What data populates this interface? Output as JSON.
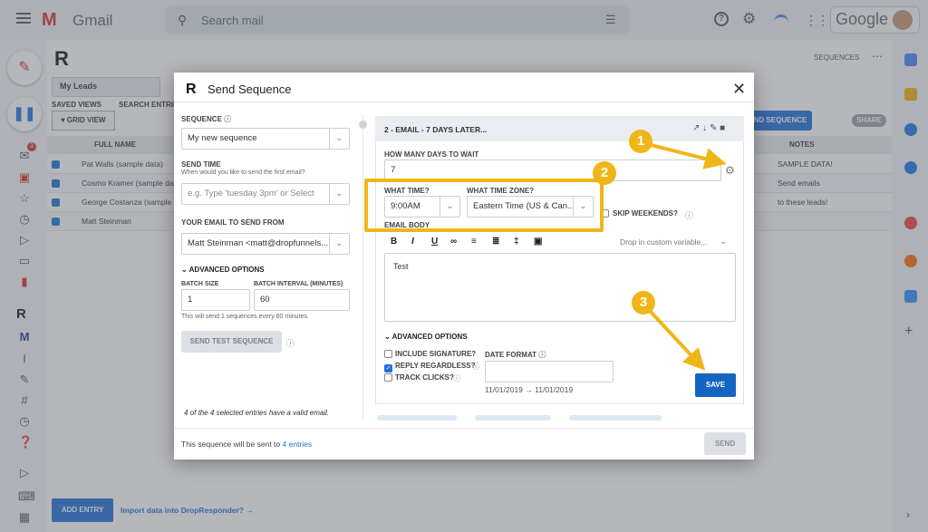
{
  "gmail": {
    "app_name": "Gmail",
    "search_placeholder": "Search mail",
    "account": "Google",
    "badge_count": "3"
  },
  "background": {
    "tab_my_leads": "My Leads",
    "saved_views": "SAVED VIEWS",
    "search_entries": "SEARCH ENTRIES",
    "grid_view": "GRID VIEW",
    "col_full_name": "FULL NAME",
    "col_notes": "NOTES",
    "rows": [
      {
        "name": "Pat Walls (sample data)",
        "note": "SAMPLE DATA!"
      },
      {
        "name": "Cosmo Kramer (sample data",
        "note": "Send emails"
      },
      {
        "name": "George Costanza (sample",
        "note": "to these leads!"
      },
      {
        "name": "Matt Steinman",
        "note": ""
      }
    ],
    "sequences_link": "SEQUENCES",
    "send_sequence_btn": "ND SEQUENCE",
    "share": "SHARE",
    "add_entry": "ADD ENTRY",
    "import_link": "Import data into DropResponder? →"
  },
  "dialog": {
    "title": "Send Sequence",
    "sequence_label": "SEQUENCE",
    "sequence_value": "My new sequence",
    "send_time_label": "SEND TIME",
    "send_time_sub": "When would you like to send the first email?",
    "send_time_placeholder": "e.g. Type 'tuesday 3pm' or Select",
    "your_email_label": "YOUR EMAIL TO SEND FROM",
    "your_email_value": "Matt Steinman <matt@dropfunnels...",
    "advanced_options": "ADVANCED OPTIONS",
    "batch_size_label": "BATCH SIZE",
    "batch_size_value": "1",
    "batch_interval_label": "BATCH INTERVAL (MINUTES)",
    "batch_interval_value": "60",
    "batch_note": "This will send 1 sequences every 60 minutes.",
    "send_test": "SEND TEST SEQUENCE",
    "valid_note": "4 of the 4 selected entries have a valid email.",
    "footer_text": "This sequence will be sent to",
    "footer_link": "4 entries",
    "send": "SEND"
  },
  "email_card": {
    "header": "2 - EMAIL - 7 DAYS LATER...",
    "days_label": "HOW MANY DAYS TO WAIT",
    "days_value": "7",
    "what_time_label": "WHAT TIME?",
    "what_time_value": "9:00AM",
    "tz_label": "WHAT TIME ZONE?",
    "tz_value": "Eastern Time (US & Can...",
    "skip_weekends": "SKIP WEEKENDS?",
    "email_body_label": "EMAIL BODY",
    "custom_variable": "Drop in custom variable...",
    "body_text": "Test",
    "advanced_options": "ADVANCED OPTIONS",
    "include_signature": "INCLUDE SIGNATURE?",
    "reply_regardless": "REPLY REGARDLESS?",
    "track_clicks": "TRACK CLICKS?",
    "date_format_label": "DATE FORMAT",
    "date_preview": "11/01/2019 → 11/01/2019",
    "save": "SAVE"
  },
  "annotations": {
    "one": "1",
    "two": "2",
    "three": "3"
  },
  "colors": {
    "accent": "#1e6fd9",
    "save": "#1565c0",
    "highlight": "#f0b618"
  }
}
